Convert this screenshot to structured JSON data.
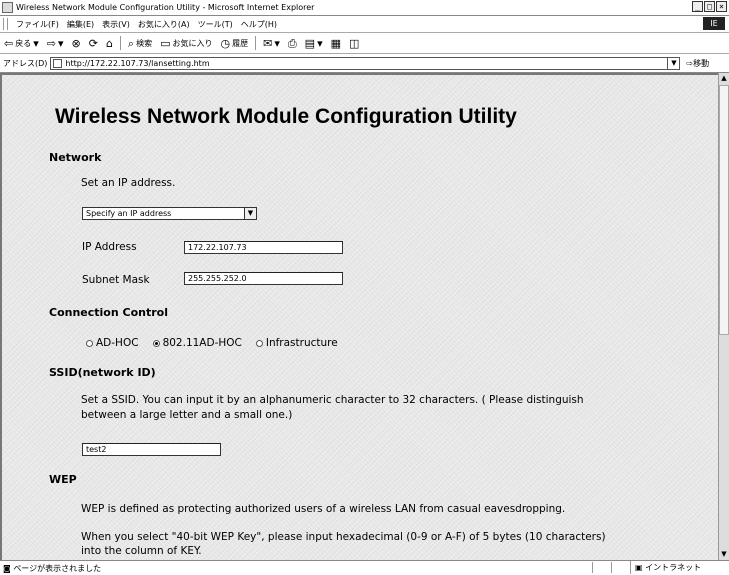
{
  "window": {
    "title": "Wireless Network Module Configuration Utility - Microsoft Internet Explorer",
    "controls": [
      "_",
      "□",
      "×"
    ]
  },
  "menu": {
    "items": [
      "ファイル(F)",
      "編集(E)",
      "表示(V)",
      "お気に入り(A)",
      "ツール(T)",
      "ヘルプ(H)"
    ],
    "throbber": "IE"
  },
  "toolbar": {
    "back": "戻る",
    "search": "検索",
    "favorites": "お気に入り",
    "history": "履歴"
  },
  "address": {
    "label": "アドレス(D)",
    "url": "http://172.22.107.73/lansetting.htm",
    "go": "移動"
  },
  "page": {
    "title": "Wireless Network Module Configuration Utility",
    "network": {
      "heading": "Network",
      "instruction": "Set  an IP address.",
      "mode_selected": "Specify an IP address",
      "ip_label": "IP Address",
      "ip_value": "172.22.107.73",
      "mask_label": "Subnet Mask",
      "mask_value": "255.255.252.0"
    },
    "connection": {
      "heading": "Connection Control",
      "options": [
        "AD-HOC",
        "802.11AD-HOC",
        "Infrastructure"
      ],
      "selected": "802.11AD-HOC"
    },
    "ssid": {
      "heading": "SSID(network ID)",
      "desc_line1": "Set a SSID. You can input it by an alphanumeric character to 32 characters. ( Please distinguish",
      "desc_line2": "between a large letter and a small one.)",
      "value": "test2"
    },
    "wep": {
      "heading": "WEP",
      "desc1": "WEP is defined as protecting authorized users of a wireless LAN from casual eavesdropping.",
      "desc2_line1": "When you select \"40-bit WEP Key\", please input hexadecimal (0-9 or A-F) of 5 bytes (10 characters)",
      "desc2_line2": "into the column of KEY."
    }
  },
  "status": {
    "text": "ページが表示されました",
    "zone": "イントラネット"
  }
}
